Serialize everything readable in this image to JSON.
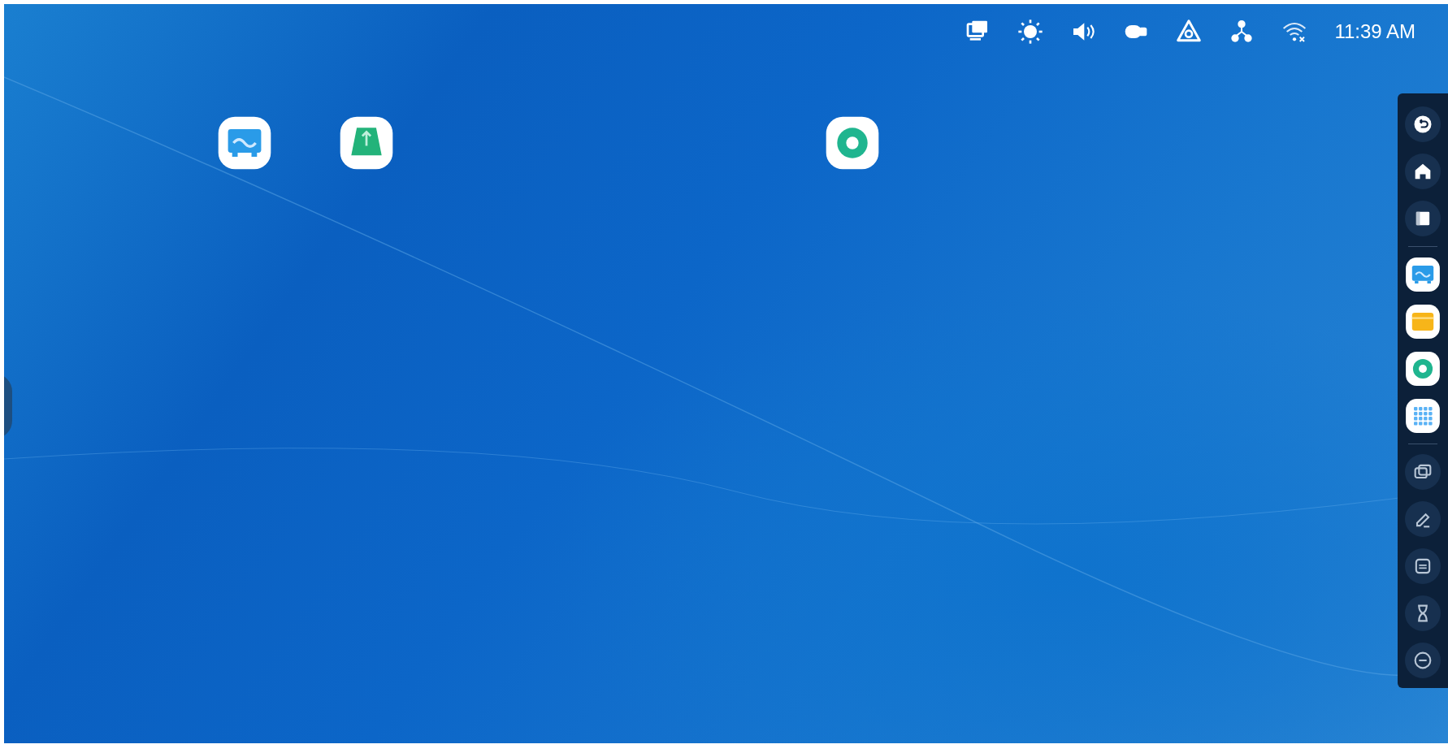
{
  "status_bar": {
    "icons": [
      {
        "kind": "screen"
      },
      {
        "kind": "brightness"
      },
      {
        "kind": "volume"
      },
      {
        "kind": "camera"
      },
      {
        "kind": "hotspot"
      },
      {
        "kind": "network"
      },
      {
        "kind": "wifi"
      }
    ],
    "time": "11:39 AM"
  },
  "desktop_icons": [
    {
      "kind": "whiteboard"
    },
    {
      "kind": "usb"
    },
    {
      "kind": "browser"
    }
  ],
  "sidebar": {
    "items": [
      {
        "kind": "back"
      },
      {
        "kind": "home"
      },
      {
        "kind": "recent"
      },
      {
        "kind": "divider"
      },
      {
        "kind": "whiteboard"
      },
      {
        "kind": "folder"
      },
      {
        "kind": "browser"
      },
      {
        "kind": "apps"
      },
      {
        "kind": "divider"
      },
      {
        "kind": "screen"
      },
      {
        "kind": "annotate"
      },
      {
        "kind": "mirror"
      },
      {
        "kind": "timer"
      },
      {
        "kind": "minimize"
      }
    ]
  }
}
